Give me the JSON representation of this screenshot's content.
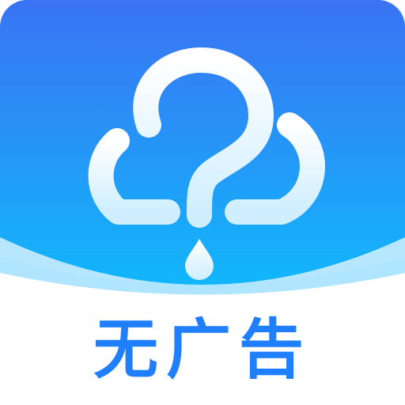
{
  "app_icon": {
    "label": "无广告",
    "icon_name": "cloud-question-rain-icon",
    "colors": {
      "gradient_top": "#3a73f3",
      "gradient_bottom": "#12b6fb",
      "wave": "#6fd0ff",
      "text": "#1f7fff",
      "glyph": "#eaf8ff"
    }
  }
}
